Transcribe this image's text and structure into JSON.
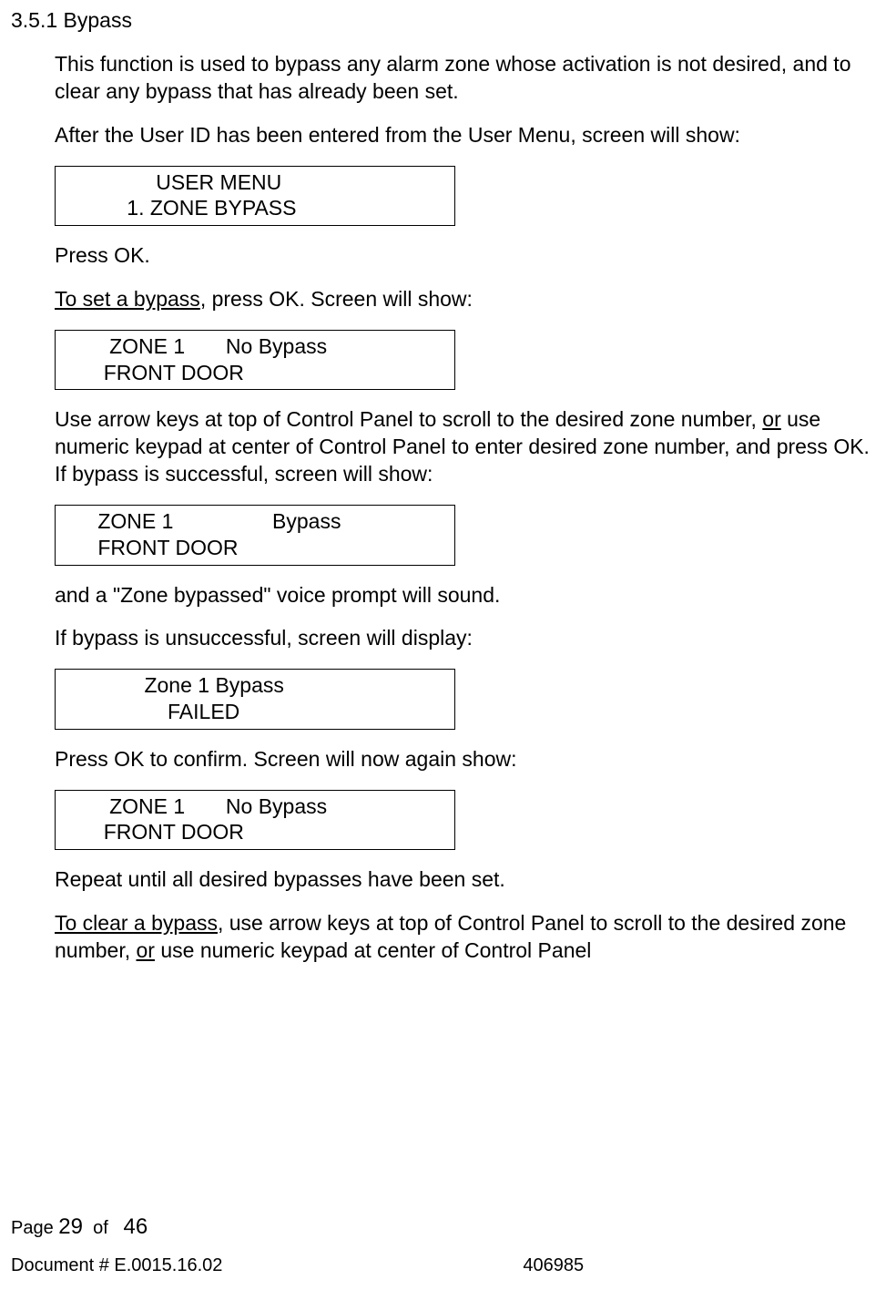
{
  "section": {
    "number": "3.5.1",
    "title": "Bypass"
  },
  "paragraphs": {
    "intro1": "This function is used to bypass any alarm zone whose activation is not desired, and to clear any bypass that has already been set.",
    "intro2": "After the User ID has been entered from the User Menu, screen will show:",
    "pressOk": "Press OK.",
    "toSetLead": "To set a bypass",
    "toSetRest": ", press OK. Screen will show:",
    "useArrow1a": "Use arrow keys at top of Control Panel to scroll to the desired zone number, ",
    "orWord": "or",
    "useArrow1b": " use numeric keypad at center of Control Panel to enter desired zone number, and press OK. If bypass is successful, screen will show:",
    "voicePrompt": "and a \"Zone bypassed\" voice prompt will sound.",
    "ifUnsuccessful": "If bypass is unsuccessful, screen will display:",
    "pressOkConfirm": "Press OK to confirm. Screen will now again show:",
    "repeat": "Repeat until all desired bypasses have been set.",
    "toClearLead": "To clear a bypass",
    "toClearRest1": ", use arrow keys at top of Control Panel to scroll to the desired zone number, ",
    "toClearRest2": " use numeric keypad at center of Control Panel"
  },
  "screens": {
    "userMenu": "                USER MENU\n           1. ZONE BYPASS",
    "zone1NoBypass": "        ZONE 1       No Bypass\n       FRONT DOOR",
    "zone1Bypass": "      ZONE 1                 Bypass\n      FRONT DOOR",
    "failed": "              Zone 1 Bypass\n                  FAILED",
    "zone1NoBypass2": "        ZONE 1       No Bypass\n       FRONT DOOR"
  },
  "footer": {
    "pageLabel": "Page",
    "pageCurrent": "29",
    "pageOf": "of",
    "pageTotal": "46",
    "docId": "Document # E.0015.16.02",
    "docNum": "406985"
  }
}
